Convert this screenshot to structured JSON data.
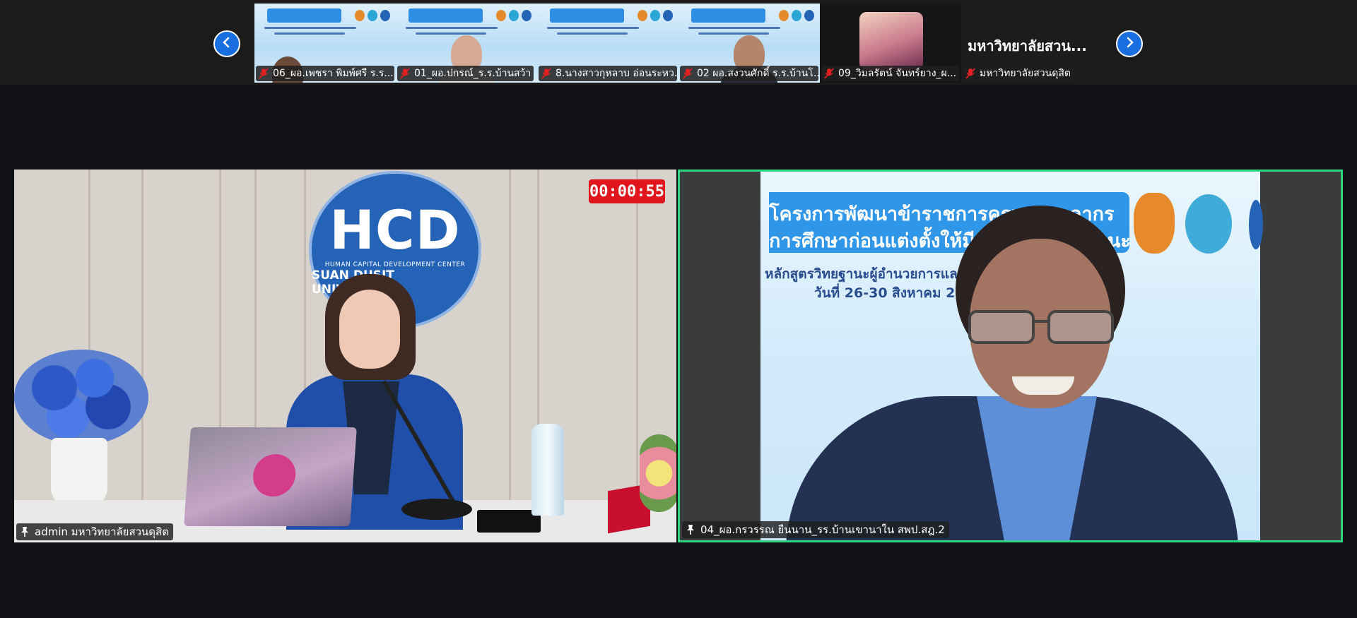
{
  "timer": "00:00:55",
  "thumbnails": [
    {
      "name": "06_ผอ.เพชรา พิมพ์ศรี ร.ร...."
    },
    {
      "name": "01_ผอ.ปกรณ์_ร.ร.บ้านสว้า"
    },
    {
      "name": "8.นางสาวกุหลาบ อ่อนระหว..."
    },
    {
      "name": "02 ผอ.สงวนศักดิ์  ร.ร.บ้านโ..."
    },
    {
      "name": "09_วิมลรัตน์ จันทร์ยาง_ผ..."
    },
    {
      "name": "มหาวิทยาลัยสวนดุสิต",
      "big_name": "มหาวิทยาลัยสวน..."
    }
  ],
  "left_tile": {
    "label": "admin มหาวิทยาลัยสวนดุสิต",
    "logo_main": "HCD",
    "logo_sub": "HUMAN CAPITAL DEVELOPMENT CENTER",
    "logo_uni": "SUAN DUSIT UNIVERSITY"
  },
  "right_tile": {
    "label": "04_ผอ.กรวรรณ ยืนนาน_รร.บ้านเขานาใน สพป.สฎ.2",
    "slide_line1": "โครงการพัฒนาข้าราชการครูและบุคลากร",
    "slide_line2": "การศึกษาก่อนแต่งตั้งให้มีและเลื่อนวิทยฐานะ",
    "slide_sub1": "หลักสูตรวิทยฐานะผู้อำนวยการและรองผู้อำนวยการ",
    "slide_sub2": "วันที่ 26-30 สิงหาคม 2568"
  },
  "colors": {
    "accent_blue": "#1a6fe0",
    "active_border": "#2fd880",
    "timer_red": "#e0161c"
  }
}
